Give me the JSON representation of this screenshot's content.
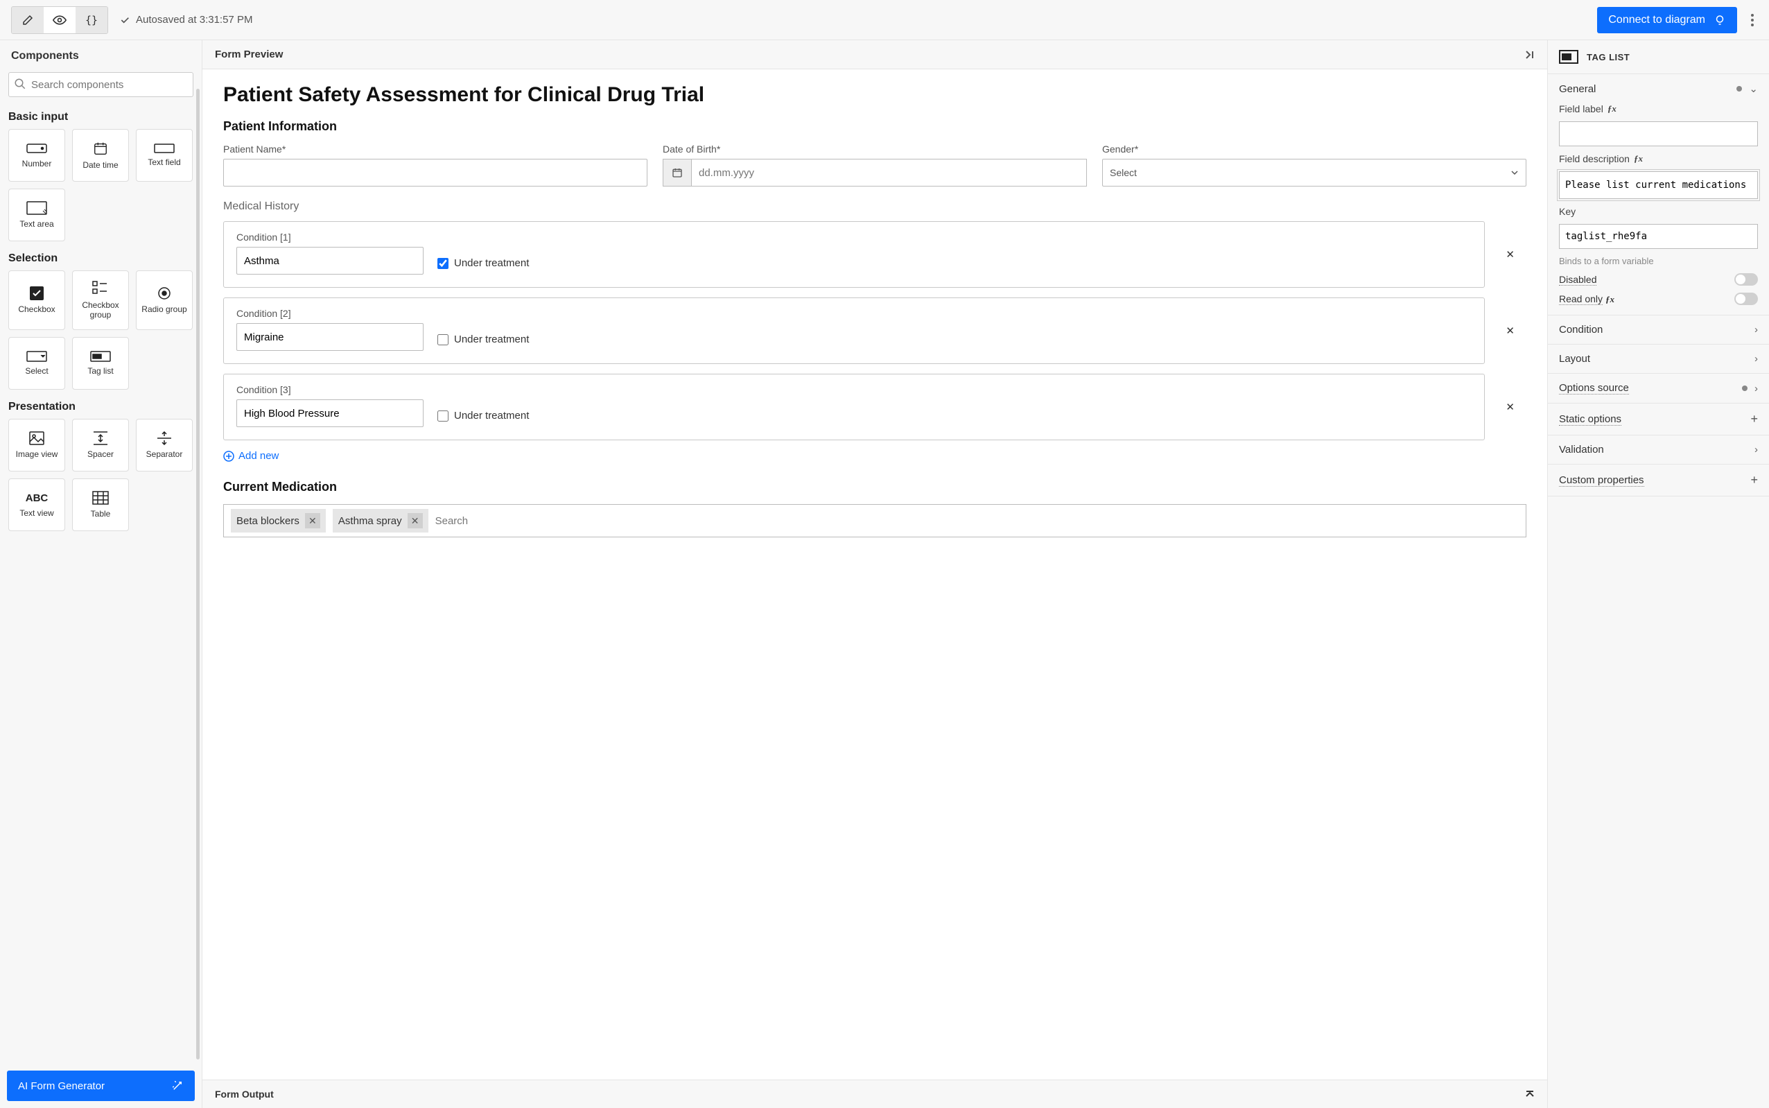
{
  "topbar": {
    "autosave": "Autosaved at 3:31:57 PM",
    "connect": "Connect to diagram"
  },
  "left": {
    "header": "Components",
    "search_placeholder": "Search components",
    "sections": {
      "basic_input": "Basic input",
      "selection": "Selection",
      "presentation": "Presentation"
    },
    "items": {
      "number": "Number",
      "datetime": "Date time",
      "textfield": "Text field",
      "textarea": "Text area",
      "checkbox": "Checkbox",
      "checkbox_group": "Checkbox group",
      "radio_group": "Radio group",
      "select": "Select",
      "taglist": "Tag list",
      "imageview": "Image view",
      "spacer": "Spacer",
      "separator": "Separator",
      "textview": "Text view",
      "table": "Table"
    },
    "ai_button": "AI Form Generator"
  },
  "center": {
    "preview_header": "Form Preview",
    "form_title": "Patient Safety Assessment for Clinical Drug Trial",
    "patient_info": "Patient Information",
    "fields": {
      "name_label": "Patient Name*",
      "dob_label": "Date of Birth*",
      "dob_placeholder": "dd.mm.yyyy",
      "gender_label": "Gender*",
      "gender_placeholder": "Select"
    },
    "medical_history": "Medical History",
    "conditions": [
      {
        "label": "Condition [1]",
        "value": "Asthma",
        "treatment_label": "Under treatment",
        "treatment": true
      },
      {
        "label": "Condition [2]",
        "value": "Migraine",
        "treatment_label": "Under treatment",
        "treatment": false
      },
      {
        "label": "Condition [3]",
        "value": "High Blood Pressure",
        "treatment_label": "Under treatment",
        "treatment": false
      }
    ],
    "add_new": "Add new",
    "current_medication": "Current Medication",
    "tags": [
      "Beta blockers",
      "Asthma spray"
    ],
    "tag_search_placeholder": "Search",
    "output_header": "Form Output"
  },
  "right": {
    "header": "TAG LIST",
    "general": "General",
    "field_label": "Field label",
    "field_description": "Field description",
    "field_description_value": "Please list current medications",
    "key_label": "Key",
    "key_value": "taglist_rhe9fa",
    "key_hint": "Binds to a form variable",
    "disabled": "Disabled",
    "readonly": "Read only",
    "sections": {
      "condition": "Condition",
      "layout": "Layout",
      "options_source": "Options source",
      "static_options": "Static options",
      "validation": "Validation",
      "custom_properties": "Custom properties"
    }
  }
}
